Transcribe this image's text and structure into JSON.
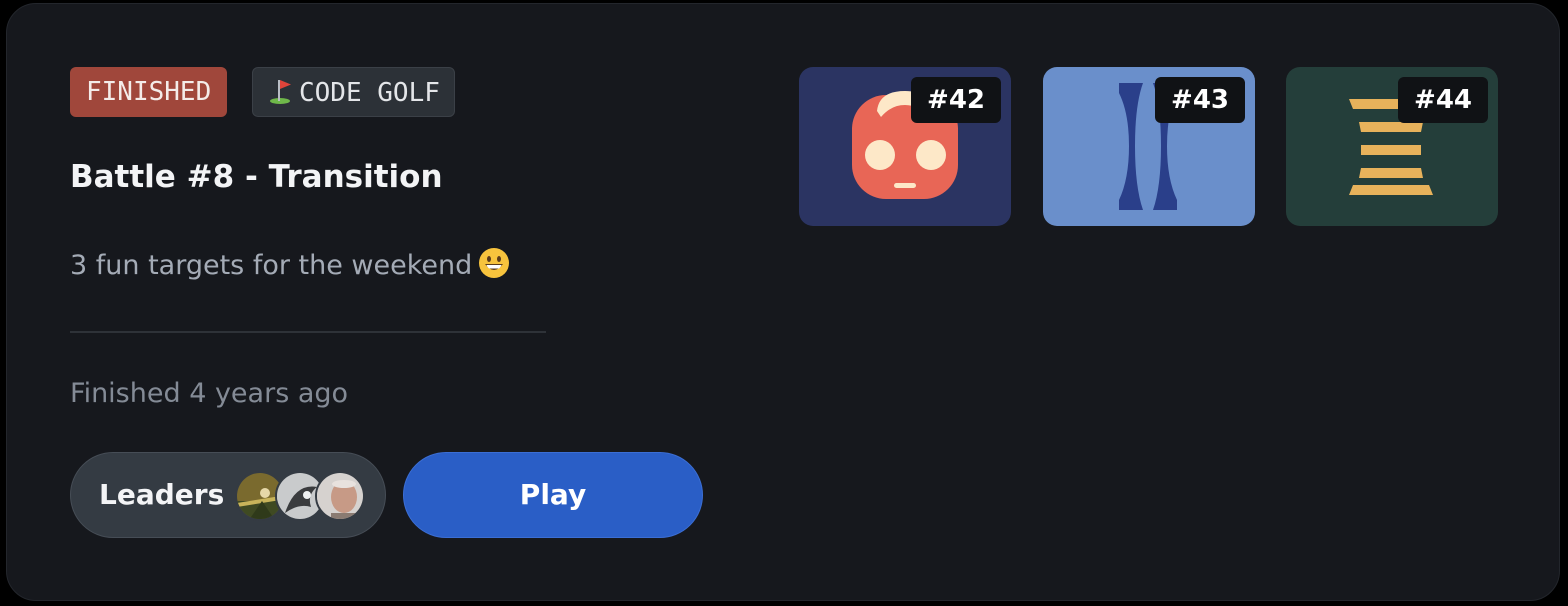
{
  "tags": {
    "status": "FINISHED",
    "mode": "CODE GOLF",
    "mode_icon": "golf-flag-icon"
  },
  "title": "Battle #8 - Transition",
  "description": "3 fun targets for the weekend",
  "description_emoji": "grinning-face-icon",
  "finished_text": "Finished 4 years ago",
  "leaders": {
    "label": "Leaders",
    "avatars": [
      "avatar-1",
      "avatar-2",
      "avatar-3"
    ]
  },
  "play_label": "Play",
  "targets": [
    {
      "number": "#42",
      "bg": "#2b3462"
    },
    {
      "number": "#43",
      "bg": "#6a8fcb"
    },
    {
      "number": "#44",
      "bg": "#243e3a"
    }
  ],
  "colors": {
    "card_bg": "#16181d",
    "finished_tag": "#a0473b",
    "play_button": "#2a5ec6"
  }
}
